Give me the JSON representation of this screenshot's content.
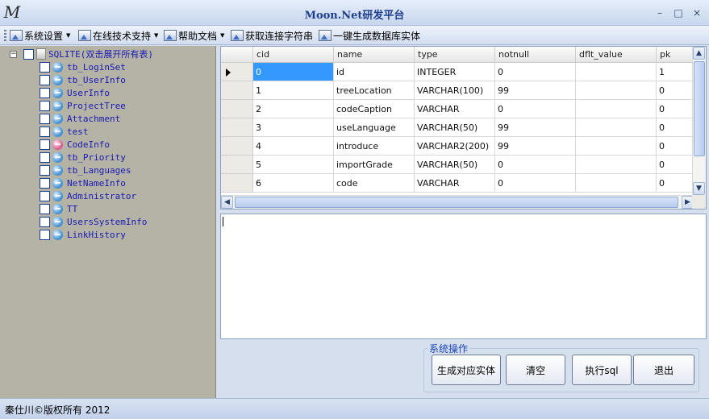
{
  "window": {
    "title": "Moon.Net研发平台",
    "logo_letter": "M",
    "minimize_glyph": "–",
    "maximize_glyph": "□",
    "close_glyph": "×"
  },
  "toolbar": {
    "items": [
      {
        "label": "系统设置",
        "icon": "settings-icon",
        "has_dropdown": true
      },
      {
        "label": "在线技术支持",
        "icon": "support-icon",
        "has_dropdown": true
      },
      {
        "label": "帮助文档",
        "icon": "help-icon",
        "has_dropdown": true
      },
      {
        "label": "获取连接字符串",
        "icon": "connection-icon",
        "has_dropdown": false
      },
      {
        "label": "一键生成数据库实体",
        "icon": "generate-icon",
        "has_dropdown": false
      }
    ],
    "dropdown_glyph": "▼"
  },
  "tree": {
    "root_label": "SQLITE(双击展开所有表)",
    "expander_glyph": "−",
    "tables": [
      "tb_LoginSet",
      "tb_UserInfo",
      "UserInfo",
      "ProjectTree",
      "Attachment",
      "test",
      "CodeInfo",
      "tb_Priority",
      "tb_Languages",
      "NetNameInfo",
      "Administrator",
      "TT",
      "UsersSystemInfo",
      "LinkHistory"
    ]
  },
  "grid": {
    "columns": [
      "cid",
      "name",
      "type",
      "notnull",
      "dflt_value",
      "pk"
    ],
    "rows": [
      [
        "0",
        "id",
        "INTEGER",
        "0",
        "",
        "1"
      ],
      [
        "1",
        "treeLocation",
        "VARCHAR(100)",
        "99",
        "",
        "0"
      ],
      [
        "2",
        "codeCaption",
        "VARCHAR",
        "0",
        "",
        "0"
      ],
      [
        "3",
        "useLanguage",
        "VARCHAR(50)",
        "99",
        "",
        "0"
      ],
      [
        "4",
        "introduce",
        "VARCHAR2(200)",
        "99",
        "",
        "0"
      ],
      [
        "5",
        "importGrade",
        "VARCHAR(50)",
        "0",
        "",
        "0"
      ],
      [
        "6",
        "code",
        "VARCHAR",
        "0",
        "",
        "0"
      ]
    ],
    "scroll_up": "▲",
    "scroll_down": "▼",
    "scroll_left": "◀",
    "scroll_right": "▶"
  },
  "output": {
    "value": ""
  },
  "actions": {
    "group_title": "系统操作",
    "generate_label": "生成对应实体",
    "clear_label": "清空",
    "execute_label": "执行sql",
    "exit_label": "退出"
  },
  "status": {
    "text": "秦仕川©版权所有 2012"
  }
}
